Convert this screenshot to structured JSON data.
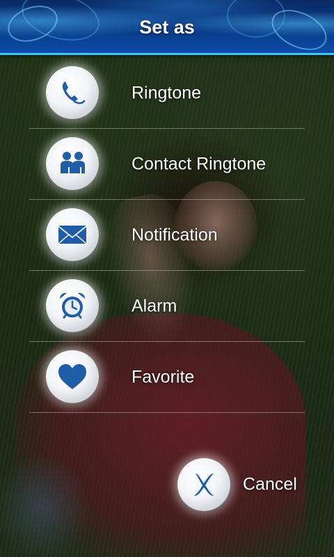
{
  "header": {
    "title": "Set as"
  },
  "menu": {
    "items": [
      {
        "label": "Ringtone",
        "icon": "phone-icon"
      },
      {
        "label": "Contact Ringtone",
        "icon": "contacts-icon"
      },
      {
        "label": "Notification",
        "icon": "envelope-icon"
      },
      {
        "label": "Alarm",
        "icon": "alarm-clock-icon"
      },
      {
        "label": "Favorite",
        "icon": "heart-icon"
      }
    ]
  },
  "cancel": {
    "label": "Cancel",
    "icon": "x-icon"
  },
  "colors": {
    "accent": "#39c8ff",
    "header": "#0b3c88",
    "icon": "#1f5da8"
  }
}
